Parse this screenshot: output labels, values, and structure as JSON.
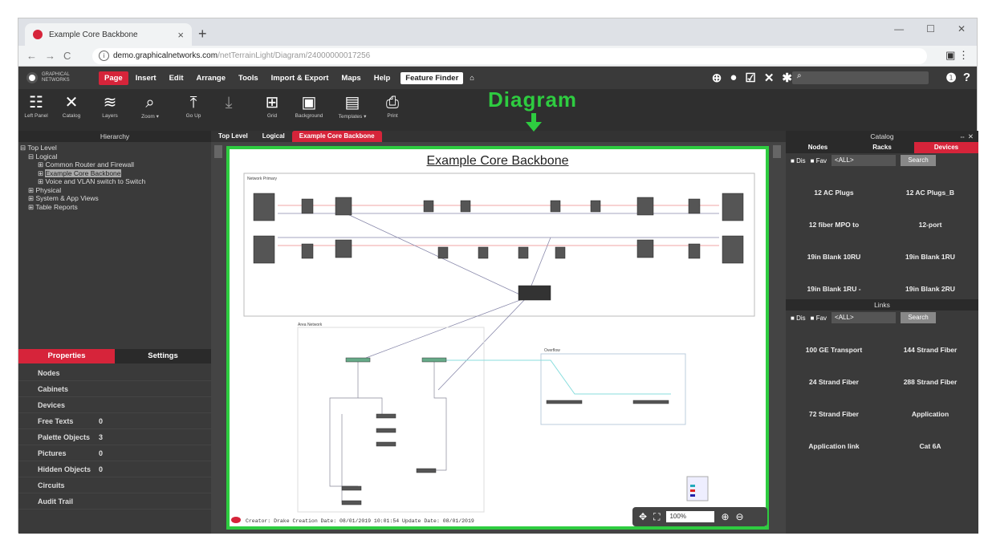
{
  "browser": {
    "tab_title": "Example Core Backbone",
    "url_host": "demo.graphicalnetworks.com",
    "url_path": "/netTerrainLight/Diagram/24000000017256"
  },
  "app": {
    "menu": [
      "Page",
      "Insert",
      "Edit",
      "Arrange",
      "Tools",
      "Import & Export",
      "Maps",
      "Help"
    ],
    "feature_finder": "Feature Finder",
    "toolbar": [
      {
        "label": "Left Panel",
        "icon": "left-panel-icon"
      },
      {
        "label": "Catalog",
        "icon": "catalog-icon"
      },
      {
        "label": "Layers",
        "icon": "layers-icon"
      },
      {
        "label": "Zoom ▾",
        "icon": "zoom-icon"
      },
      {
        "label": "Go Up",
        "icon": "go-up-icon"
      },
      {
        "label": "Grid",
        "icon": "grid-icon"
      },
      {
        "label": "Background",
        "icon": "background-icon"
      },
      {
        "label": "Templates ▾",
        "icon": "templates-icon"
      },
      {
        "label": "Print",
        "icon": "print-icon"
      }
    ]
  },
  "annotation": {
    "label": "Diagram",
    "color": "#2ecc40"
  },
  "left_panel": {
    "title": "Hierarchy",
    "tree": [
      "Top Level",
      "Logical",
      "Common Router and Firewall",
      "Example Core Backbone",
      "Voice and VLAN switch to Switch",
      "Physical",
      "System & App Views",
      "Table Reports"
    ],
    "tabs": [
      "Properties",
      "Settings"
    ],
    "properties": [
      {
        "key": "Nodes",
        "value": "",
        "red": true
      },
      {
        "key": "Cabinets",
        "value": "",
        "red": true
      },
      {
        "key": "Devices",
        "value": "",
        "red": true
      },
      {
        "key": "Free Texts",
        "value": "0",
        "red": false
      },
      {
        "key": "Palette Objects",
        "value": "3",
        "red": false
      },
      {
        "key": "Pictures",
        "value": "0",
        "red": false
      },
      {
        "key": "Hidden Objects",
        "value": "0",
        "red": false
      },
      {
        "key": "Circuits",
        "value": "",
        "red": true
      },
      {
        "key": "Audit Trail",
        "value": "",
        "red": true
      }
    ]
  },
  "center": {
    "tabs": [
      "Top Level",
      "Logical",
      "Example Core Backbone"
    ],
    "diagram_title": "Example Core Backbone",
    "section_labels": [
      "Network Primary",
      "Area Network",
      "Overflow"
    ],
    "footer": "Creator: Drake        Creation Date: 08/01/2019 10:01:54        Update Date: 08/01/2019",
    "zoom": "100%"
  },
  "right_panel": {
    "title": "Catalog",
    "tabs": [
      "Nodes",
      "Racks",
      "Devices"
    ],
    "filter_dis": "Dis",
    "filter_fav": "Fav",
    "filter_all": "<ALL>",
    "search": "Search",
    "devices": [
      "12 AC Plugs",
      "12 AC Plugs_B",
      "12 fiber MPO to",
      "12-port",
      "19in Blank 10RU",
      "19in Blank 1RU",
      "19in Blank 1RU -",
      "19in Blank 2RU"
    ],
    "links_title": "Links",
    "links": [
      "100 GE Transport",
      "144 Strand Fiber",
      "24 Strand Fiber",
      "288 Strand Fiber",
      "72 Strand Fiber",
      "Application",
      "Application link",
      "Cat 6A"
    ]
  }
}
